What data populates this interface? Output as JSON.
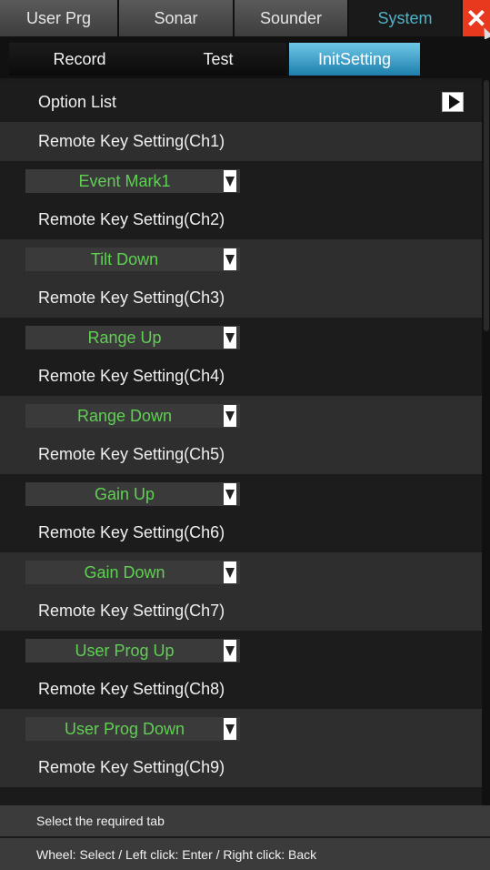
{
  "top_tabs": [
    {
      "label": "User Prg",
      "active": false
    },
    {
      "label": "Sonar",
      "active": false
    },
    {
      "label": "Sounder",
      "active": false
    },
    {
      "label": "System",
      "active": true
    }
  ],
  "sub_tabs": [
    {
      "label": "Record",
      "active": false
    },
    {
      "label": "Test",
      "active": false
    },
    {
      "label": "InitSetting",
      "active": true
    }
  ],
  "close_icon": "close-icon",
  "option_list": {
    "label": "Option List",
    "icon": "play-icon"
  },
  "settings": [
    {
      "label": "Remote Key Setting(Ch1)",
      "value": "Event Mark1"
    },
    {
      "label": "Remote Key Setting(Ch2)",
      "value": "Tilt Down"
    },
    {
      "label": "Remote Key Setting(Ch3)",
      "value": "Range Up"
    },
    {
      "label": "Remote Key Setting(Ch4)",
      "value": "Range Down"
    },
    {
      "label": "Remote Key Setting(Ch5)",
      "value": "Gain Up"
    },
    {
      "label": "Remote Key Setting(Ch6)",
      "value": "Gain Down"
    },
    {
      "label": "Remote Key Setting(Ch7)",
      "value": "User Prog Up"
    },
    {
      "label": "Remote Key Setting(Ch8)",
      "value": "User Prog Down"
    },
    {
      "label": "Remote Key Setting(Ch9)",
      "value": null
    }
  ],
  "status": {
    "hint": "Select the required tab",
    "controls": "Wheel: Select / Left click: Enter / Right click: Back"
  },
  "colors": {
    "accent": "#4fb3c8",
    "value_text": "#5fd052",
    "close": "#e8391f"
  }
}
